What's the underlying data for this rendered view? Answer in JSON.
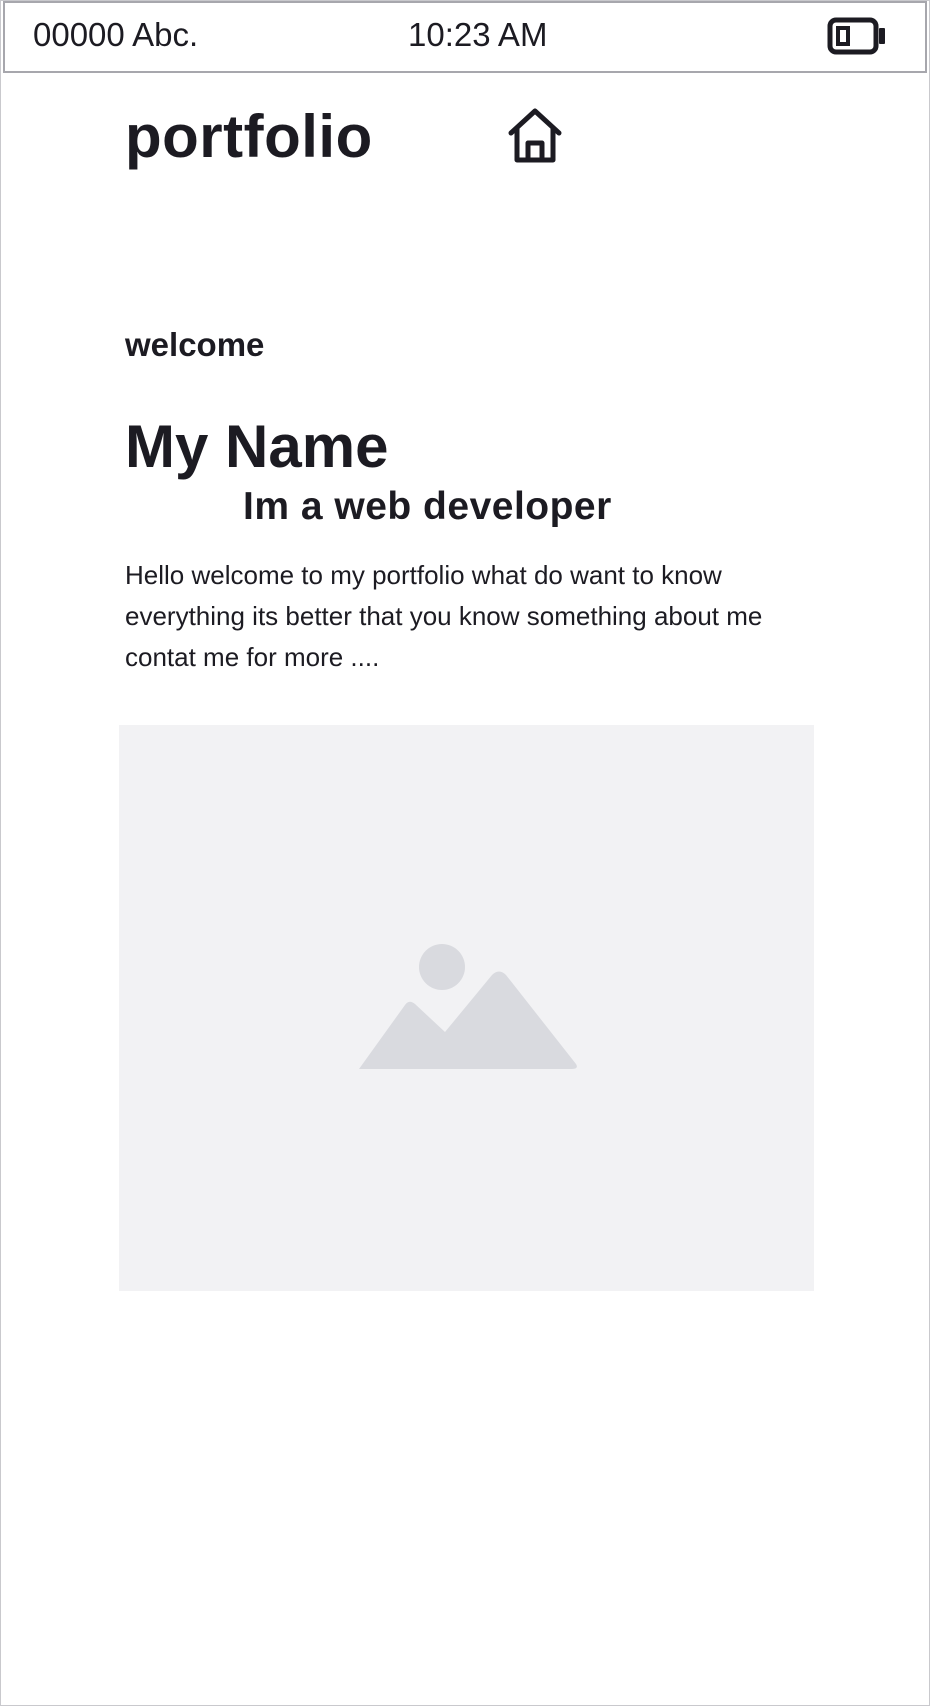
{
  "status_bar": {
    "carrier": "00000 Abc.",
    "time": "10:23 AM",
    "battery_icon": "battery-icon"
  },
  "header": {
    "brand": "portfolio",
    "home_icon": "home-icon"
  },
  "hero": {
    "welcome": "welcome",
    "name": "My Name",
    "role": "Im a web developer",
    "intro": "Hello welcome to my portfolio what do want to know everything its better that you know something about me contat me for more ...."
  },
  "media": {
    "placeholder_icon": "image-placeholder-icon",
    "background_color": "#f2f2f4",
    "icon_color": "#d9dadf"
  },
  "colors": {
    "text": "#1c1b22",
    "background": "#ffffff"
  }
}
